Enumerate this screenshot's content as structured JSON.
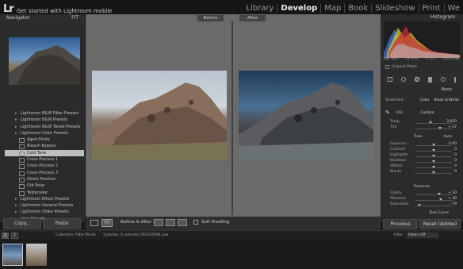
{
  "app": {
    "logo": "Lr",
    "promo_line1": "",
    "promo_line2": "Get started with Lightroom mobile"
  },
  "modules": [
    "Library",
    "Develop",
    "Map",
    "Book",
    "Slideshow",
    "Print",
    "We"
  ],
  "active_module": "Develop",
  "navigator": {
    "title": "Navigator",
    "zoom": "FIT"
  },
  "presets": [
    {
      "label": "Lightroom B&W Filter Presets",
      "group": true
    },
    {
      "label": "Lightroom B&W Presets",
      "group": true
    },
    {
      "label": "Lightroom B&W Toned Presets",
      "group": true
    },
    {
      "label": "Lightroom Color Presets",
      "group": true
    },
    {
      "label": "Aged Photo",
      "group": false
    },
    {
      "label": "Bleach Bypass",
      "group": false
    },
    {
      "label": "Cold Tone",
      "group": false,
      "selected": true
    },
    {
      "label": "Cross Process 1",
      "group": false
    },
    {
      "label": "Cross Process 2",
      "group": false
    },
    {
      "label": "Cross Process 3",
      "group": false
    },
    {
      "label": "Direct Positive",
      "group": false
    },
    {
      "label": "Old Polar",
      "group": false
    },
    {
      "label": "Yesteryear",
      "group": false
    },
    {
      "label": "Lightroom Effect Presets",
      "group": true
    },
    {
      "label": "Lightroom General Presets",
      "group": true
    },
    {
      "label": "Lightroom Video Presets",
      "group": true
    },
    {
      "label": "User Presets",
      "group": true
    }
  ],
  "left_buttons": {
    "copy": "Copy...",
    "paste": "Paste"
  },
  "before_label": "Before",
  "after_label": "After",
  "toolbar": {
    "before_after": "Before & After :",
    "soft_proofing": "Soft Proofing"
  },
  "histogram": {
    "title": "Histogram",
    "iso": "ISO 320",
    "focal": "11 mm",
    "aperture": "f / 11",
    "shutter": "1/250 sec",
    "original": "Original Photo"
  },
  "basic": {
    "title": "Basic",
    "treatment_label": "Treatment :",
    "color": "Color",
    "bw": "Black & White",
    "wb_label": "WB :",
    "wb_value": "Custom",
    "temp": {
      "label": "Temp",
      "value": "3,650",
      "pos": 0.42
    },
    "tint": {
      "label": "Tint",
      "value": "+ 47",
      "pos": 0.68
    },
    "tone_label": "Tone",
    "auto": "Auto",
    "exposure": {
      "label": "Exposure",
      "value": "0.00",
      "pos": 0.5
    },
    "contrast": {
      "label": "Contrast",
      "value": "0",
      "pos": 0.5
    },
    "highlights": {
      "label": "Highlights",
      "value": "0",
      "pos": 0.5
    },
    "shadows": {
      "label": "Shadows",
      "value": "0",
      "pos": 0.5
    },
    "whites": {
      "label": "Whites",
      "value": "0",
      "pos": 0.5
    },
    "blacks": {
      "label": "Blacks",
      "value": "0",
      "pos": 0.5
    },
    "presence_label": "Presence",
    "clarity": {
      "label": "Clarity",
      "value": "+ 30",
      "pos": 0.65
    },
    "vibrance": {
      "label": "Vibrance",
      "value": "+ 38",
      "pos": 0.69
    },
    "saturation": {
      "label": "Saturation",
      "value": "- 79",
      "pos": 0.1
    },
    "next_panel": "Tone Curve"
  },
  "right_buttons": {
    "previous": "Previous",
    "reset": "Reset (Adobe)"
  },
  "filmstrip": {
    "page1": "1",
    "page2": "2",
    "collection": "Collection: Filter Brush",
    "count": "2 photos /1 selected /DSC04184.arw",
    "filter_label": "Filter :",
    "filter_value": "Filters Off"
  }
}
